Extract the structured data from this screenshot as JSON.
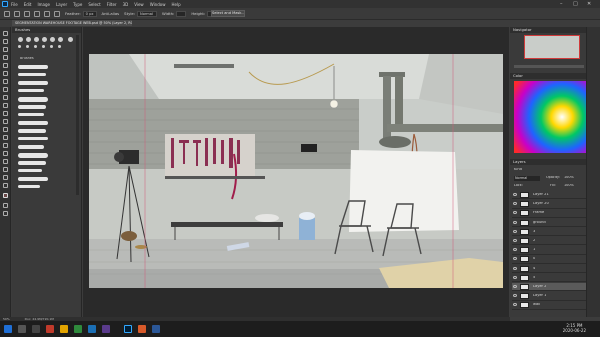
{
  "menubar": {
    "items": [
      "File",
      "Edit",
      "Image",
      "Layer",
      "Type",
      "Select",
      "Filter",
      "3D",
      "View",
      "Window",
      "Help"
    ],
    "window_controls": [
      "–",
      "□",
      "✕"
    ]
  },
  "optbar": {
    "feather_label": "Feather:",
    "feather_value": "0 px",
    "antialias_label": "Anti-alias",
    "style_label": "Style:",
    "style_value": "Normal",
    "width_label": "Width:",
    "height_label": "Height:",
    "select_mask": "Select and Mask..."
  },
  "document": {
    "tab_title": "SEGMENTATION WAREHOUSE FOOTAGE WEB.psd @ 50% (Layer 2, RGB/8) *"
  },
  "brushes_panel": {
    "title": "Brushes",
    "group_label": "Brushes"
  },
  "navigator": {
    "title": "Navigator"
  },
  "color_panel": {
    "title": "Color"
  },
  "layers_panel": {
    "title": "Layers",
    "kind_label": "Kind",
    "blend_mode": "Normal",
    "opacity_label": "Opacity:",
    "opacity_value": "100%",
    "lock_label": "Lock:",
    "fill_label": "Fill:",
    "fill_value": "100%",
    "layers": [
      {
        "name": "Layer 21"
      },
      {
        "name": "Layer 20"
      },
      {
        "name": "Frame"
      },
      {
        "name": "ground"
      },
      {
        "name": "3"
      },
      {
        "name": "2"
      },
      {
        "name": "1"
      },
      {
        "name": "0"
      },
      {
        "name": "4"
      },
      {
        "name": "5"
      },
      {
        "name": "Layer 2"
      },
      {
        "name": "Layer 1"
      },
      {
        "name": "wall"
      }
    ],
    "selected_index": 10
  },
  "status": {
    "zoom": "50%",
    "doc_info": "Doc: 24.9M/720.1M"
  },
  "taskbar": {
    "time": "2:15 PM",
    "date": "2020-06-22"
  },
  "colors": {
    "accent": "#31a8ff",
    "canvas_bg": "#2a2a2a",
    "panel_bg": "#3a3a3a"
  }
}
